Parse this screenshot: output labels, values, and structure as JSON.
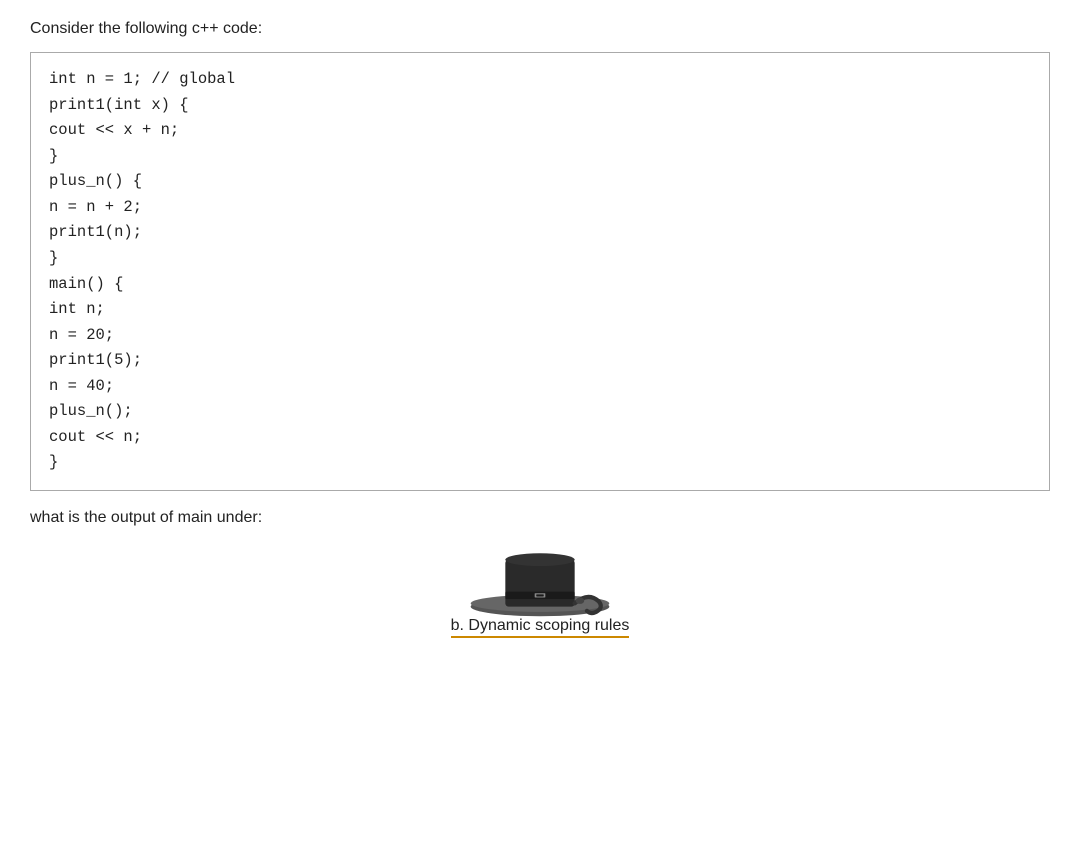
{
  "intro": {
    "text": "Consider the following c++ code:"
  },
  "code": {
    "lines": [
      "int n = 1; // global",
      "print1(int x) {",
      "cout << x + n;",
      "}",
      "plus_n() {",
      "n = n + 2;",
      "print1(n);",
      "}",
      "main() {",
      "int n;",
      "n = 20;",
      "print1(5);",
      "n = 40;",
      "plus_n();",
      "cout << n;",
      "}"
    ]
  },
  "question": {
    "text": "what is the output of main under:"
  },
  "options": {
    "b": {
      "label": "b. Dynamic scoping rules"
    }
  }
}
